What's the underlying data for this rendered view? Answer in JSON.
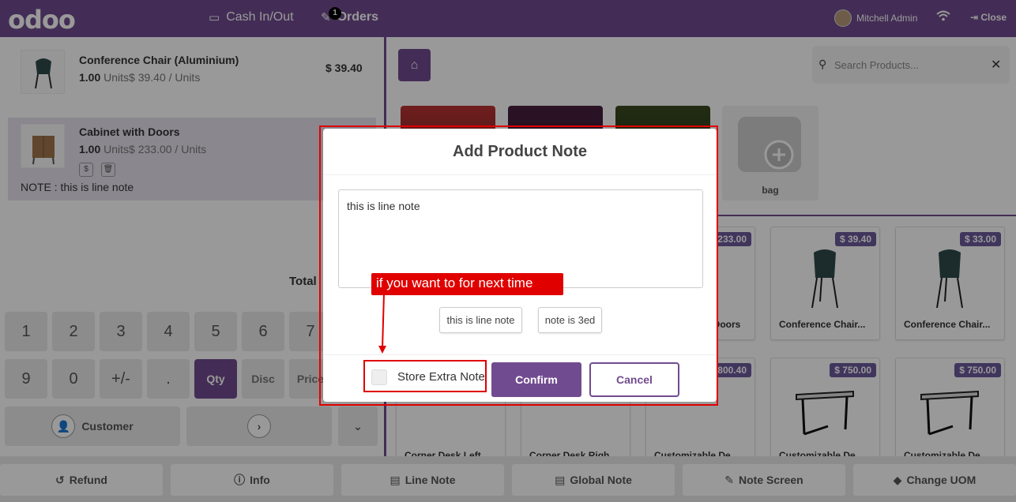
{
  "topbar": {
    "logo": "odoo",
    "cash_label": "Cash In/Out",
    "orders_label": "Orders",
    "orders_count": "1",
    "user_name": "Mitchell Admin",
    "close_label": "Close"
  },
  "order": {
    "lines": [
      {
        "name": "Conference Chair (Aluminium)",
        "qty": "1.00",
        "unit_info": "Units$ 39.40 / Units",
        "price": "$ 39.40"
      },
      {
        "name": "Cabinet with Doors",
        "qty": "1.00",
        "unit_info": "Units$ 233.00 / Units",
        "note": "NOTE : this is line note",
        "price_partial": "$"
      }
    ],
    "total_label": "Total"
  },
  "numpad": {
    "row1": [
      "1",
      "2",
      "3",
      "4",
      "5",
      "6",
      "7"
    ],
    "row2": [
      "9",
      "0",
      "+/-",
      ".",
      "Qty",
      "Disc",
      "Price"
    ],
    "customer_label": "Customer"
  },
  "products": {
    "search_placeholder": "Search Products...",
    "category_bag": "bag",
    "cards": [
      {
        "price": "$ 233.00",
        "name": "Cabinet with Doors"
      },
      {
        "price": "$ 39.40",
        "name": "Conference Chair..."
      },
      {
        "price": "$ 33.00",
        "name": "Conference Chair..."
      },
      {
        "price": "$ 800.40",
        "name": "Customizable Desk"
      },
      {
        "price": "$ 750.00",
        "name": "Customizable De..."
      },
      {
        "price": "$ 750.00",
        "name": "Customizable De..."
      },
      {
        "name": "Corner Desk Left..."
      },
      {
        "name": "Corner Desk Righ..."
      },
      {
        "name": "Customizable De..."
      }
    ]
  },
  "controls": {
    "refund": "Refund",
    "info": "Info",
    "line_note": "Line Note",
    "global_note": "Global Note",
    "note_screen": "Note Screen",
    "change_uom": "Change UOM"
  },
  "modal": {
    "title": "Add Product Note",
    "note_value": "this is line note",
    "chips": [
      "this is line note",
      "note is 3ed"
    ],
    "store_label": "Store Extra Note",
    "confirm_label": "Confirm",
    "cancel_label": "Cancel"
  },
  "annotation": {
    "callout_text": "if you want to for next time"
  },
  "colors": {
    "brand": "#714b8f",
    "annotation_red": "#e00000"
  }
}
